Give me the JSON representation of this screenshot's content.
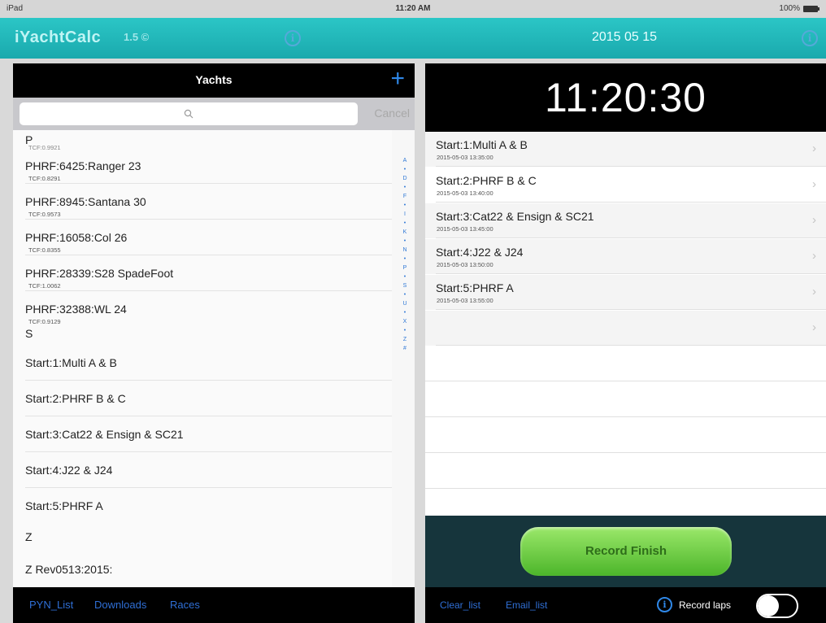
{
  "status": {
    "device": "iPad",
    "time": "11:20 AM",
    "battery": "100%"
  },
  "header": {
    "app_name": "iYachtCalc",
    "version": "1.5",
    "date": "2015 05 15"
  },
  "yachts_panel": {
    "title": "Yachts",
    "add_label": "+",
    "cancel_label": "Cancel",
    "rows": [
      {
        "type": "section",
        "label": "P",
        "subtitle": "TCF:0.9921"
      },
      {
        "type": "item",
        "label": "PHRF:6425:Ranger 23",
        "subtitle": "TCF:0.8291"
      },
      {
        "type": "item",
        "label": "PHRF:8945:Santana 30",
        "subtitle": "TCF:0.9573"
      },
      {
        "type": "item",
        "label": "PHRF:16058:Col 26",
        "subtitle": "TCF:0.8355"
      },
      {
        "type": "item",
        "label": "PHRF:28339:S28 SpadeFoot",
        "subtitle": "TCF:1.0062"
      },
      {
        "type": "item",
        "label": "PHRF:32388:WL 24",
        "subtitle": "TCF:0.9129"
      },
      {
        "type": "section",
        "label": "S"
      },
      {
        "type": "item",
        "label": "Start:1:Multi A & B"
      },
      {
        "type": "item",
        "label": "Start:2:PHRF B & C"
      },
      {
        "type": "item",
        "label": "Start:3:Cat22 & Ensign & SC21"
      },
      {
        "type": "item",
        "label": "Start:4:J22 & J24"
      },
      {
        "type": "item",
        "label": "Start:5:PHRF A"
      },
      {
        "type": "section",
        "label": "Z"
      },
      {
        "type": "item",
        "label": "Z Rev0513:2015:"
      }
    ],
    "index": [
      "A",
      "•",
      "D",
      "•",
      "F",
      "•",
      "I",
      "•",
      "K",
      "•",
      "N",
      "•",
      "P",
      "•",
      "S",
      "•",
      "U",
      "•",
      "X",
      "•",
      "Z",
      "#"
    ]
  },
  "left_footer": {
    "links": [
      "PYN_List",
      "Downloads",
      "Races"
    ]
  },
  "clock": {
    "time": "11:20:30"
  },
  "starts_list": [
    {
      "title": "Start:1:Multi A & B",
      "time": "2015-05-03 13:35:00"
    },
    {
      "title": "Start:2:PHRF B & C",
      "time": "2015-05-03 13:40:00"
    },
    {
      "title": "Start:3:Cat22 & Ensign & SC21",
      "time": "2015-05-03 13:45:00"
    },
    {
      "title": "Start:4:J22 & J24",
      "time": "2015-05-03 13:50:00"
    },
    {
      "title": "Start:5:PHRF A",
      "time": "2015-05-03 13:55:00"
    },
    {
      "title": "",
      "time": ""
    }
  ],
  "record_button": "Record Finish",
  "right_footer": {
    "clear": "Clear_list",
    "email": "Email_list",
    "laps_label": "Record laps",
    "laps_on": false
  },
  "colors": {
    "teal": "#1aa9ad",
    "link": "#2f6fd6",
    "record_green": "#4cb52a"
  }
}
